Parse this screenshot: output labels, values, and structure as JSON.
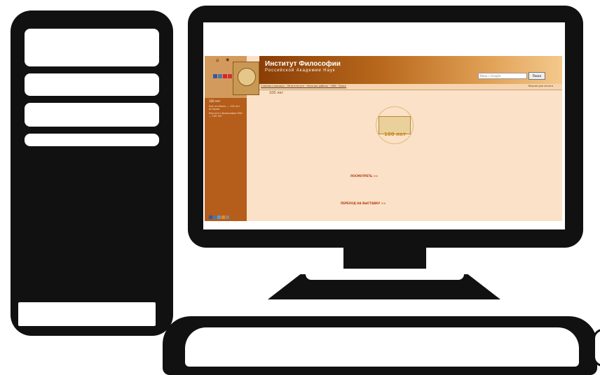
{
  "site": {
    "title": "Институт Философии",
    "subtitle": "Российской Академии Наук",
    "search_placeholder": "Ввод с Google",
    "search_button": "Поиск",
    "page_heading": "100 лет",
    "seal_text": "100 лет",
    "nav_links": "Главная страница · Об институте · Научные работы · СМИ · Поиск",
    "nav_right": "Версия для печати",
    "left_menu_title": "100 лет",
    "left_menu_items": [
      "Как это было — 100 лет истории",
      "Институт философии РАН — 100 лет"
    ],
    "center_link_1": "ПОСМОТРЕТЬ >>",
    "center_link_2": "ПЕРЕХОД НА ВЫСТАВКУ >>",
    "colors": {
      "header": "#8a3e06",
      "background": "#fbe1c7",
      "sidebar": "#b55d1b",
      "link": "#b0401a"
    }
  },
  "icons": [
    "home-icon",
    "rss-icon",
    "social-icons",
    "seal-emblem"
  ]
}
